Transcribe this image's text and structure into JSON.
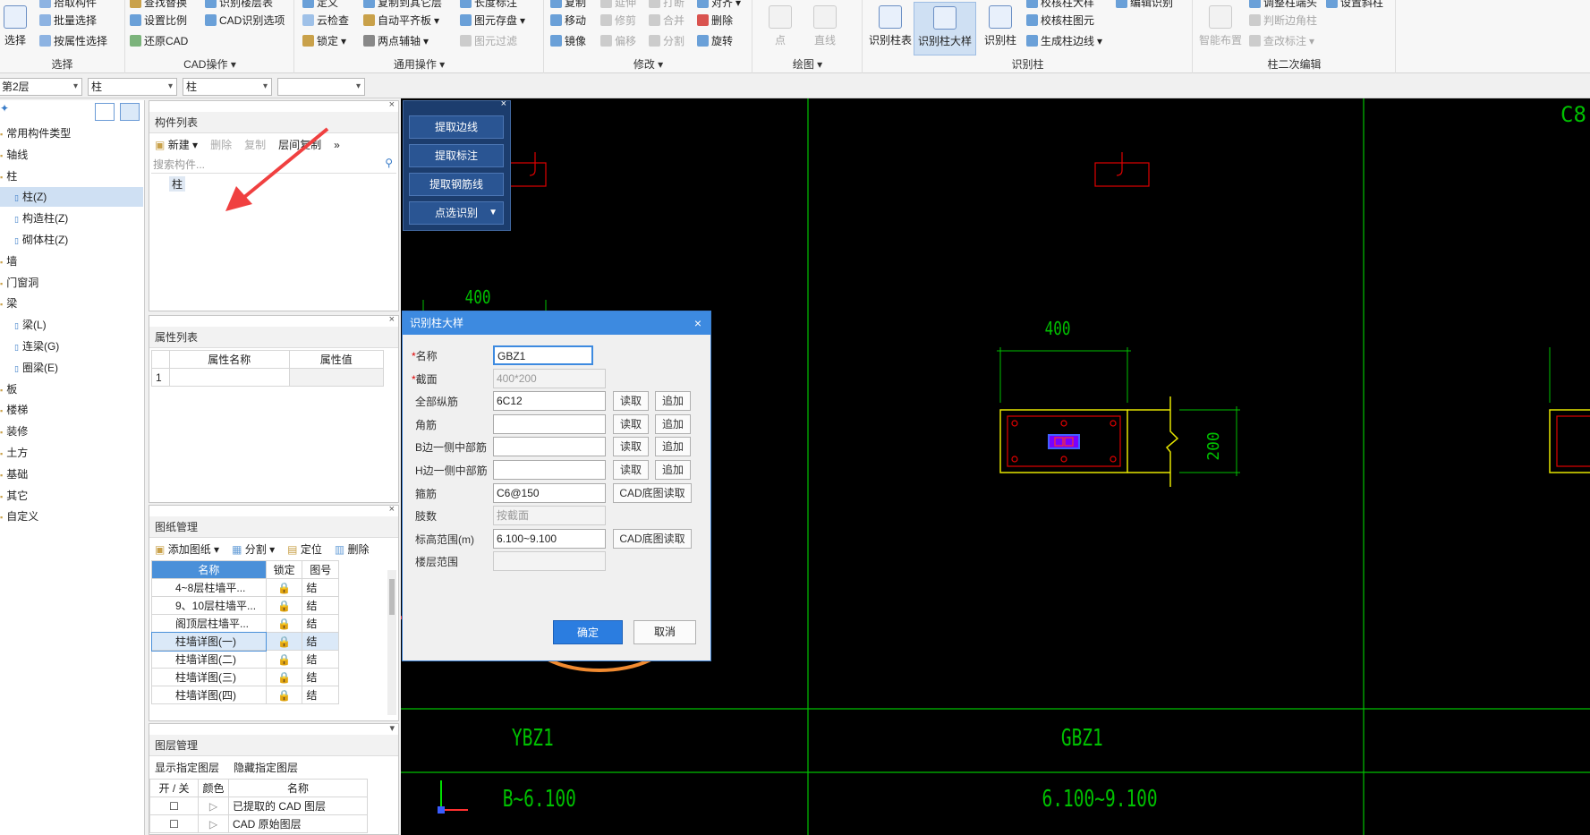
{
  "ribbon": {
    "groups": {
      "select": {
        "label": "选择",
        "big": "选择",
        "items": [
          "拾取构件",
          "批量选择",
          "按属性选择"
        ]
      },
      "cad": {
        "label": "CAD操作",
        "items": [
          "查找替换",
          "识别楼层表",
          "设置比例",
          "CAD识别选项",
          "还原CAD"
        ]
      },
      "common": {
        "label": "通用操作",
        "items": [
          "定义",
          "复制到其它层",
          "长度标注",
          "云检查",
          "自动平齐板",
          "图元存盘",
          "锁定",
          "两点辅轴",
          "图元过滤"
        ]
      },
      "modify": {
        "label": "修改",
        "items": [
          "复制",
          "延伸",
          "打断",
          "对齐",
          "移动",
          "修剪",
          "合并",
          "删除",
          "镜像",
          "偏移",
          "分割",
          "旋转"
        ]
      },
      "draw": {
        "label": "绘图",
        "items": [
          "点",
          "直线"
        ]
      },
      "identify": {
        "label": "识别柱",
        "big": [
          "识别柱表",
          "识别柱大样",
          "识别柱"
        ],
        "items": [
          "校核柱大样",
          "校核柱图元",
          "生成柱边线",
          "编辑识别"
        ]
      },
      "secondary": {
        "label": "柱二次编辑",
        "big": "智能布置",
        "items": [
          "调整柱端头",
          "设置斜柱",
          "判断边角柱",
          "查改标注"
        ]
      }
    }
  },
  "toolrow": {
    "floor": "第2层",
    "type1": "柱",
    "type2": "柱",
    "type3": ""
  },
  "tree": {
    "items": [
      {
        "label": "常用构件类型"
      },
      {
        "label": "轴线"
      },
      {
        "label": "柱"
      },
      {
        "label": "柱(Z)",
        "child": true,
        "selected": true
      },
      {
        "label": "构造柱(Z)",
        "child": true
      },
      {
        "label": "砌体柱(Z)",
        "child": true
      },
      {
        "label": "墙"
      },
      {
        "label": "门窗洞"
      },
      {
        "label": "梁"
      },
      {
        "label": "梁(L)",
        "child": true
      },
      {
        "label": "连梁(G)",
        "child": true
      },
      {
        "label": "圈梁(E)",
        "child": true
      },
      {
        "label": "板"
      },
      {
        "label": "楼梯"
      },
      {
        "label": "装修"
      },
      {
        "label": "土方"
      },
      {
        "label": "基础"
      },
      {
        "label": "其它"
      },
      {
        "label": "自定义"
      }
    ]
  },
  "component_list": {
    "title": "构件列表",
    "new": "新建",
    "delete": "删除",
    "copy": "复制",
    "layer_copy": "层间复制",
    "search_placeholder": "搜索构件...",
    "item": "柱"
  },
  "property_list": {
    "title": "属性列表",
    "col_name": "属性名称",
    "col_value": "属性值",
    "row_num": "1"
  },
  "drawing_mgmt": {
    "title": "图纸管理",
    "add": "添加图纸",
    "split": "分割",
    "locate": "定位",
    "delete": "删除",
    "cols": [
      "名称",
      "锁定",
      "图号"
    ],
    "rows": [
      {
        "name": "4~8层柱墙平...",
        "code": "结"
      },
      {
        "name": "9、10层柱墙平...",
        "code": "结"
      },
      {
        "name": "阁顶层柱墙平...",
        "code": "结"
      },
      {
        "name": "柱墙详图(一)",
        "code": "结",
        "selected": true
      },
      {
        "name": "柱墙详图(二)",
        "code": "结"
      },
      {
        "name": "柱墙详图(三)",
        "code": "结"
      },
      {
        "name": "柱墙详图(四)",
        "code": "结"
      }
    ]
  },
  "layer_mgmt": {
    "title": "图层管理",
    "show": "显示指定图层",
    "hide": "隐藏指定图层",
    "cols": [
      "开 / 关",
      "颜色",
      "名称"
    ],
    "rows": [
      {
        "name": "已提取的 CAD 图层"
      },
      {
        "name": "CAD 原始图层"
      }
    ]
  },
  "float_panel": {
    "buttons": [
      "提取边线",
      "提取标注",
      "提取钢筋线",
      "点选识别"
    ]
  },
  "canvas": {
    "dim_400_left": "400",
    "dim_400_mid": "400",
    "dim_200": "200",
    "label_ybz1": "YBZ1",
    "label_gbz1": "GBZ1",
    "label_b6100": "B~6.100",
    "label_range": "6.100~9.100",
    "label_c8": "C8"
  },
  "dialog": {
    "title": "识别柱大样",
    "fields": [
      {
        "label": "名称",
        "required": true,
        "value": "GBZ1"
      },
      {
        "label": "截面",
        "required": true,
        "value": "400*200",
        "disabled": true
      },
      {
        "label": "全部纵筋",
        "value": "6C12"
      },
      {
        "label": "角筋",
        "value": ""
      },
      {
        "label": "B边一侧中部筋",
        "value": ""
      },
      {
        "label": "H边一侧中部筋",
        "value": ""
      },
      {
        "label": "箍筋",
        "value": "C6@150"
      },
      {
        "label": "肢数",
        "value": "按截面",
        "disabled": true
      },
      {
        "label": "标高范围(m)",
        "value": "6.100~9.100"
      },
      {
        "label": "楼层范围",
        "value": "",
        "disabled": true
      }
    ],
    "read": "读取",
    "append": "追加",
    "cad_read": "CAD底图读取",
    "ok": "确定",
    "cancel": "取消"
  },
  "colors": {
    "accent": "#3d8ae0",
    "cad_green": "#00c000",
    "cad_red": "#e00000",
    "cad_yellow": "#e6e600",
    "annot": "#f08a30",
    "arrow": "#f04040"
  }
}
